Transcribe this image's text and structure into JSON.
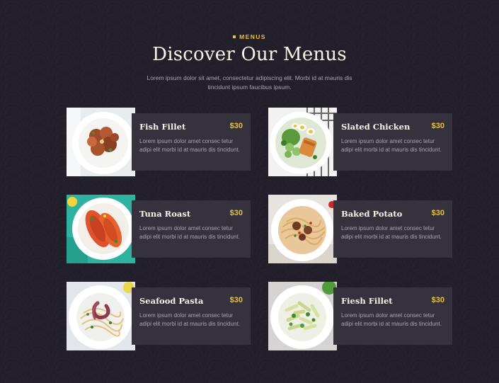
{
  "header": {
    "eyebrow": "MENUS",
    "title": "Discover Our Menus",
    "subtitle": "Lorem ipsum dolor sit amet, consectetur adipiscing elit. Morbi id at mauris dis tincidunt ipsum faucibus ipsum."
  },
  "menu": {
    "items": [
      {
        "name": "Fish Fillet",
        "price": "$30",
        "description": "Lorem ipsum dolor amet consec tetur adipi elit morbi id at mauris dis tincidunt."
      },
      {
        "name": "Slated Chicken",
        "price": "$30",
        "description": "Lorem ipsum dolor amet consec tetur adipi elit morbi id at mauris dis tincidunt."
      },
      {
        "name": "Tuna Roast",
        "price": "$30",
        "description": "Lorem ipsum dolor amet consec tetur adipi elit morbi id at mauris dis tincidunt."
      },
      {
        "name": "Baked Potato",
        "price": "$30",
        "description": "Lorem ipsum dolor amet consec tetur adipi elit morbi id at mauris dis tincidunt."
      },
      {
        "name": "Seafood Pasta",
        "price": "$30",
        "description": "Lorem ipsum dolor amet consec tetur adipi elit morbi id at mauris dis tincidunt."
      },
      {
        "name": "Fiesh Fillet",
        "price": "$30",
        "description": "Lorem ipsum dolor amet consec tetur adipi elit morbi id at mauris dis tincidunt."
      }
    ]
  },
  "colors": {
    "background": "#221f2b",
    "panel": "#35323e",
    "accent": "#e9c23a",
    "title": "#f6f2ea",
    "muted_text": "#a7a4b2"
  }
}
